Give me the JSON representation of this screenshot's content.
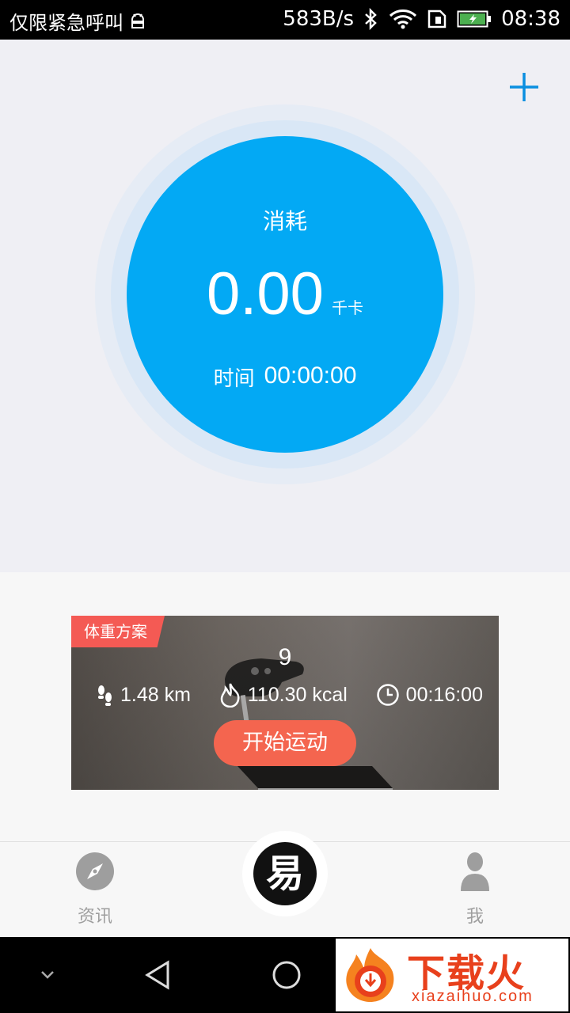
{
  "status_bar": {
    "carrier": "仅限紧急呼叫",
    "net_speed": "583B/s",
    "time": "08:38"
  },
  "workout": {
    "consume_label": "消耗",
    "calories": "0.00",
    "calorie_unit": "千卡",
    "time_label": "时间",
    "time_value": "00:00:00"
  },
  "plan_card": {
    "tag": "体重方案",
    "number": "9",
    "distance": "1.48 km",
    "calories": "110.30 kcal",
    "duration": "00:16:00",
    "start_label": "开始运动"
  },
  "bottom_nav": {
    "news_label": "资讯",
    "center_label": "易",
    "me_label": "我"
  },
  "watermark": {
    "text": "下载火",
    "sub": "xiazaihuo.com"
  },
  "colors": {
    "accent": "#03a9f4",
    "start_button": "#f4654f",
    "tag": "#f45a54"
  }
}
